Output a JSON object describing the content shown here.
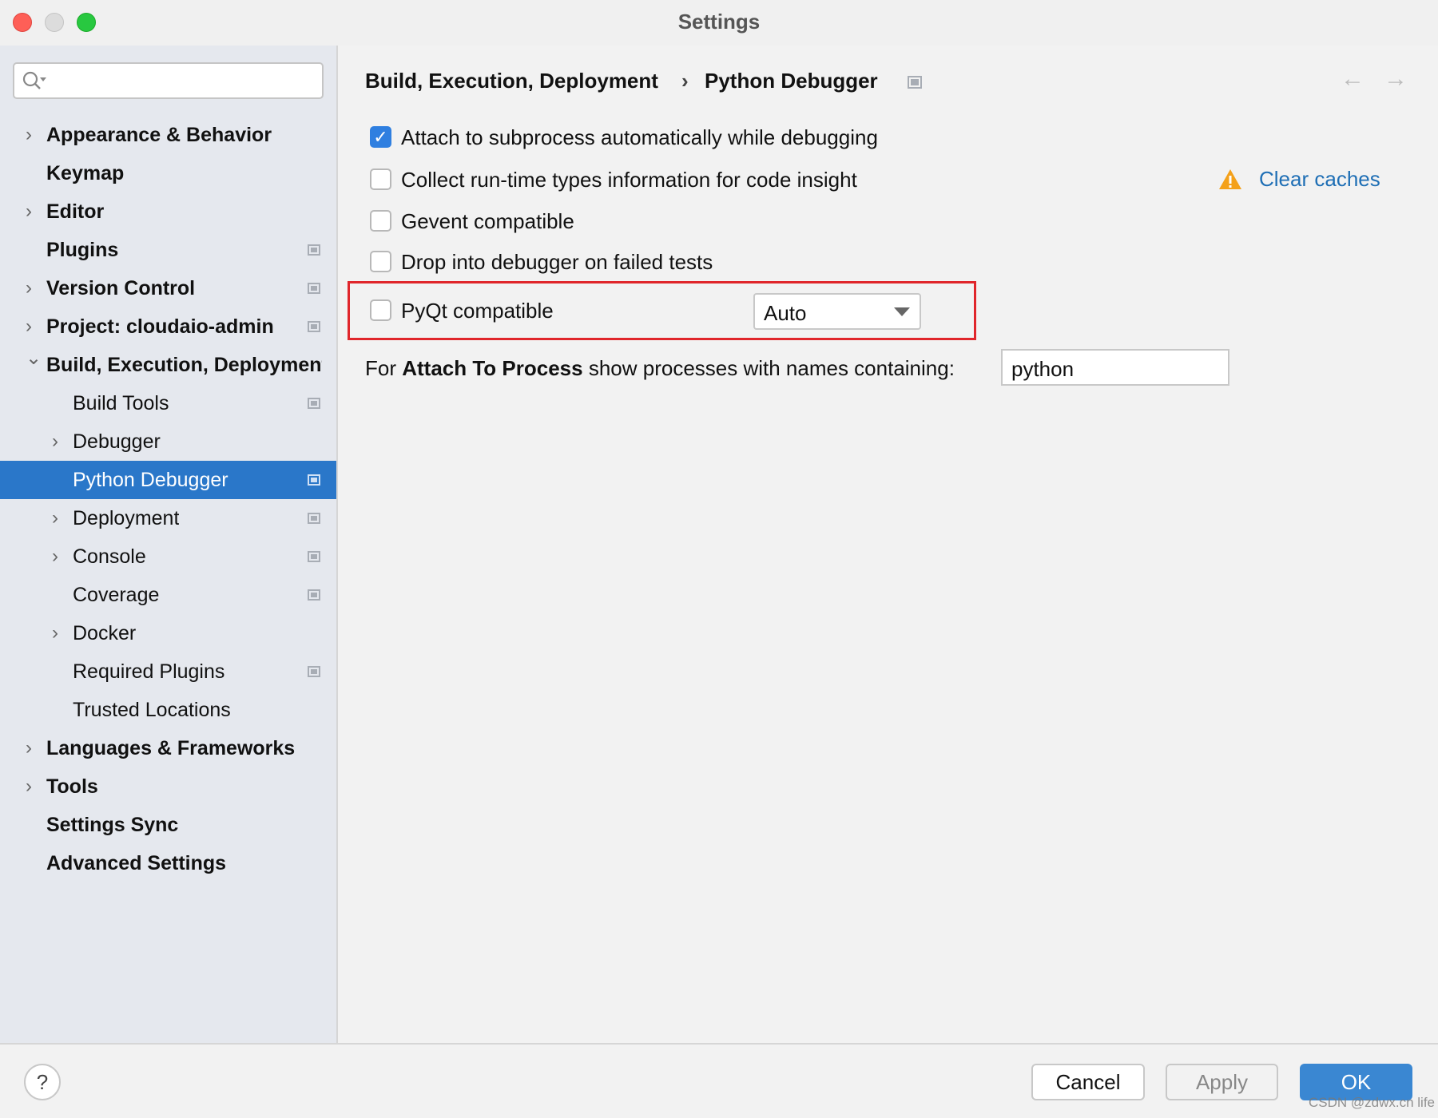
{
  "window": {
    "title": "Settings"
  },
  "search": {
    "placeholder": ""
  },
  "tree": [
    {
      "label": "Appearance & Behavior",
      "level": 0,
      "chevron": "right",
      "icon": false
    },
    {
      "label": "Keymap",
      "level": 0,
      "chevron": "none",
      "icon": false
    },
    {
      "label": "Editor",
      "level": 0,
      "chevron": "right",
      "icon": false
    },
    {
      "label": "Plugins",
      "level": 0,
      "chevron": "none",
      "icon": true
    },
    {
      "label": "Version Control",
      "level": 0,
      "chevron": "right",
      "icon": true
    },
    {
      "label": "Project: cloudaio-admin",
      "level": 0,
      "chevron": "right",
      "icon": true
    },
    {
      "label": "Build, Execution, Deployment",
      "level": 0,
      "chevron": "down",
      "icon": false
    },
    {
      "label": "Build Tools",
      "level": 1,
      "chevron": "none",
      "icon": true
    },
    {
      "label": "Debugger",
      "level": 1,
      "chevron": "right",
      "icon": false
    },
    {
      "label": "Python Debugger",
      "level": 1,
      "chevron": "none",
      "icon": true,
      "selected": true
    },
    {
      "label": "Deployment",
      "level": 1,
      "chevron": "right",
      "icon": true
    },
    {
      "label": "Console",
      "level": 1,
      "chevron": "right",
      "icon": true
    },
    {
      "label": "Coverage",
      "level": 1,
      "chevron": "none",
      "icon": true
    },
    {
      "label": "Docker",
      "level": 1,
      "chevron": "right",
      "icon": false
    },
    {
      "label": "Required Plugins",
      "level": 1,
      "chevron": "none",
      "icon": true
    },
    {
      "label": "Trusted Locations",
      "level": 1,
      "chevron": "none",
      "icon": false
    },
    {
      "label": "Languages & Frameworks",
      "level": 0,
      "chevron": "right",
      "icon": false
    },
    {
      "label": "Tools",
      "level": 0,
      "chevron": "right",
      "icon": false
    },
    {
      "label": "Settings Sync",
      "level": 0,
      "chevron": "none",
      "icon": false
    },
    {
      "label": "Advanced Settings",
      "level": 0,
      "chevron": "none",
      "icon": false
    }
  ],
  "breadcrumb": {
    "parent": "Build, Execution, Deployment",
    "separator": "›",
    "current": "Python Debugger"
  },
  "options": [
    {
      "label": "Attach to subprocess automatically while debugging",
      "checked": true
    },
    {
      "label": "Collect run-time types information for code insight",
      "checked": false
    },
    {
      "label": "Gevent compatible",
      "checked": false
    },
    {
      "label": "Drop into debugger on failed tests",
      "checked": false
    }
  ],
  "clear_caches": {
    "label": "Clear caches",
    "icon": "warning-icon",
    "color": "#1f6fb5"
  },
  "pyqt": {
    "label": "PyQt compatible",
    "checked": false,
    "select_value": "Auto",
    "highlight_color": "#e0262b"
  },
  "attach": {
    "prefix": "For ",
    "bold": "Attach To Process",
    "suffix": " show processes with names containing:",
    "value": "python"
  },
  "footer": {
    "help": "?",
    "cancel": "Cancel",
    "apply": "Apply",
    "ok": "OK"
  },
  "watermark": "CSDN @zdwx.cn life",
  "colors": {
    "accent": "#2a77c9",
    "ok_button": "#3a87d2"
  }
}
